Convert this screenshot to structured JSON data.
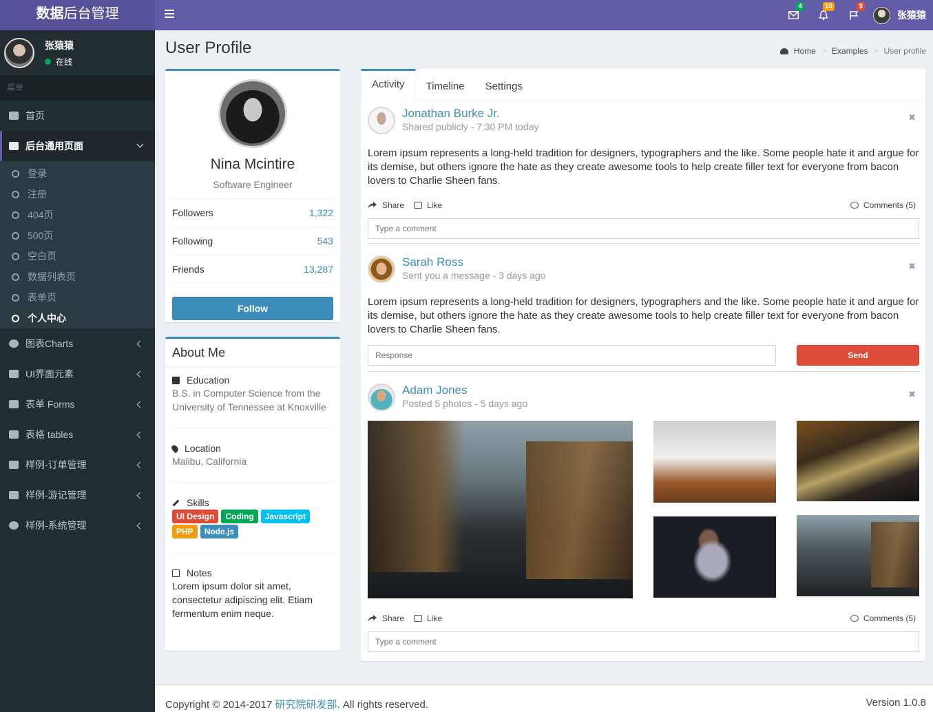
{
  "app": {
    "title_bold": "数据",
    "title_rest": "后台管理"
  },
  "topbar": {
    "mail_badge": "4",
    "notifications_badge": "10",
    "flag_badge": "9",
    "user_name": "张猿猿"
  },
  "sidebar": {
    "user_name": "张猿猿",
    "status": "在线",
    "menu_header": "菜单",
    "items": {
      "home": "首页",
      "general": "后台通用页面",
      "charts": "图表Charts",
      "ui": "UI界面元素",
      "forms": "表单 Forms",
      "tables": "表格 tables",
      "orders": "样例-订单管理",
      "travel": "样例-游记管理",
      "system": "样例-系统管理"
    },
    "subitems": [
      "登录",
      "注册",
      "404页",
      "500页",
      "空白页",
      "数据列表页",
      "表单页",
      "个人中心"
    ]
  },
  "content": {
    "page_title": "User Profile",
    "breadcrumb": {
      "home": "Home",
      "examples": "Examples",
      "current": "User profile"
    }
  },
  "profile": {
    "name": "Nina Mcintire",
    "job": "Software Engineer",
    "stats": [
      {
        "label": "Followers",
        "value": "1,322"
      },
      {
        "label": "Following",
        "value": "543"
      },
      {
        "label": "Friends",
        "value": "13,287"
      }
    ],
    "follow_label": "Follow"
  },
  "about": {
    "title": "About Me",
    "education_title": "Education",
    "education_text": "B.S. in Computer Science from the University of Tennessee at Knoxville",
    "location_title": "Location",
    "location_text": "Malibu, California",
    "skills_title": "Skills",
    "skills": [
      "UI Design",
      "Coding",
      "Javascript",
      "PHP",
      "Node.js"
    ],
    "notes_title": "Notes",
    "notes_text": "Lorem ipsum dolor sit amet, consectetur adipiscing elit. Etiam fermentum enim neque."
  },
  "tabs": [
    "Activity",
    "Timeline",
    "Settings"
  ],
  "posts": [
    {
      "name": "Jonathan Burke Jr.",
      "desc": "Shared publicly - 7:30 PM today",
      "text": "Lorem ipsum represents a long-held tradition for designers, typographers and the like. Some people hate it and argue for its demise, but others ignore the hate as they create awesome tools to help create filler text for everyone from bacon lovers to Charlie Sheen fans.",
      "share": "Share",
      "like": "Like",
      "comments": "Comments (5)",
      "placeholder": "Type a comment"
    },
    {
      "name": "Sarah Ross",
      "desc": "Sent you a message - 3 days ago",
      "text": "Lorem ipsum represents a long-held tradition for designers, typographers and the like. Some people hate it and argue for its demise, but others ignore the hate as they create awesome tools to help create filler text for everyone from bacon lovers to Charlie Sheen fans.",
      "placeholder": "Response",
      "send": "Send"
    },
    {
      "name": "Adam Jones",
      "desc": "Posted 5 photos - 5 days ago",
      "share": "Share",
      "like": "Like",
      "comments": "Comments (5)",
      "placeholder": "Type a comment"
    }
  ],
  "footer": {
    "copyright_pre": "Copyright © 2014-2017 ",
    "org": "研究院研发部",
    "copyright_post": ". All rights reserved.",
    "version": "Version 1.0.8"
  }
}
